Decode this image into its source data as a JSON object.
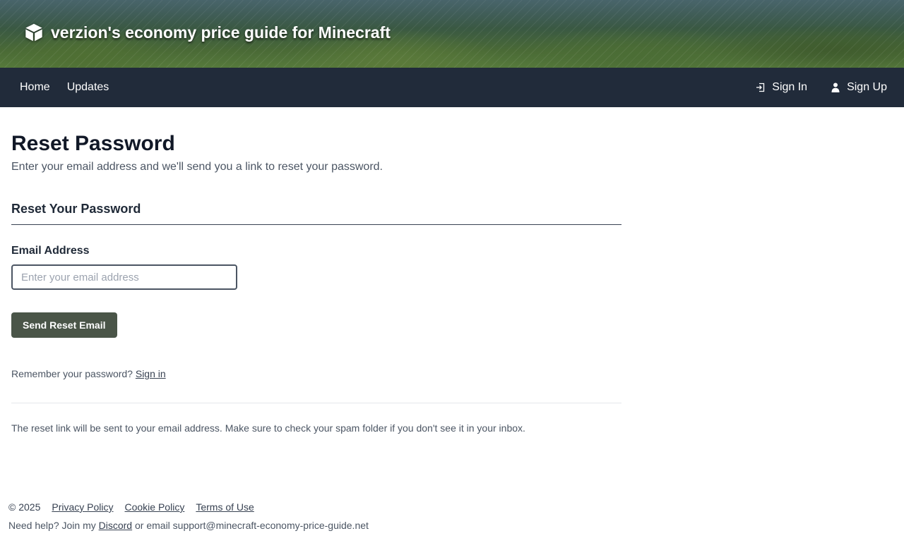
{
  "header": {
    "site_title": "verzion's economy price guide for Minecraft",
    "logo_icon": "cube-icon"
  },
  "nav": {
    "home": "Home",
    "updates": "Updates",
    "sign_in": "Sign In",
    "sign_up": "Sign Up",
    "sign_in_icon": "sign-in-icon",
    "sign_up_icon": "user-icon"
  },
  "main": {
    "title": "Reset Password",
    "subtitle": "Enter your email address and we'll send you a link to reset your password.",
    "section_title": "Reset Your Password",
    "email_label": "Email Address",
    "email_placeholder": "Enter your email address",
    "email_value": "",
    "submit_label": "Send Reset Email",
    "remember_text": "Remember your password?",
    "remember_link": "Sign in",
    "note": "The reset link will be sent to your email address. Make sure to check your spam folder if you don't see it in your inbox."
  },
  "footer": {
    "copyright": "© 2025",
    "privacy": "Privacy Policy",
    "cookie": "Cookie Policy",
    "terms": "Terms of Use",
    "help_prefix": "Need help? Join my",
    "discord": "Discord",
    "help_suffix": "or email support@minecraft-economy-price-guide.net"
  },
  "colors": {
    "nav_bg": "#212b3a",
    "button_bg": "#4a5548",
    "heading": "#111827"
  }
}
